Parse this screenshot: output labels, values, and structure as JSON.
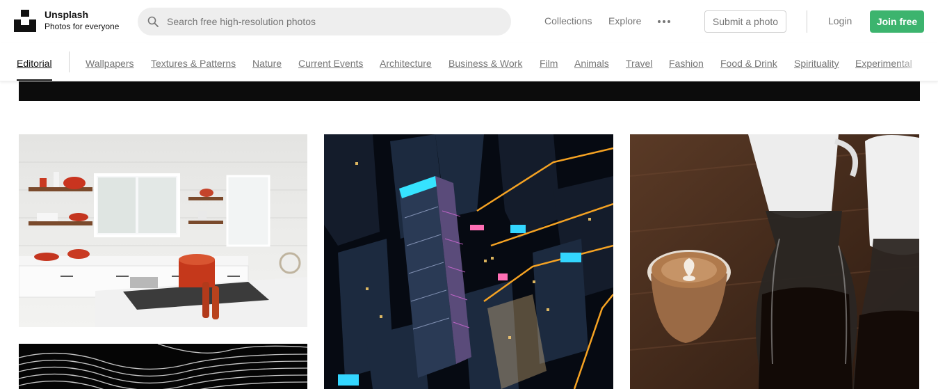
{
  "brand": {
    "name": "Unsplash",
    "tagline": "Photos for everyone",
    "logo_icon": "unsplash-logo-icon"
  },
  "search": {
    "placeholder": "Search free high-resolution photos",
    "value": "",
    "icon": "search-icon"
  },
  "nav": {
    "collections": "Collections",
    "explore": "Explore",
    "more_icon": "more-horizontal-icon",
    "submit": "Submit a photo",
    "login": "Login",
    "join": "Join free"
  },
  "topics": {
    "active": "Editorial",
    "items": [
      "Wallpapers",
      "Textures & Patterns",
      "Nature",
      "Current Events",
      "Architecture",
      "Business & Work",
      "Film",
      "Animals",
      "Travel",
      "Fashion",
      "Food & Drink",
      "Spirituality",
      "Experimental"
    ]
  },
  "colors": {
    "accent_green": "#3cb46e",
    "text_primary": "#111111",
    "text_secondary": "#767676",
    "search_bg": "#eeeeee"
  },
  "photos": [
    {
      "subject": "white kitchen with red cookware"
    },
    {
      "subject": "aerial city at night"
    },
    {
      "subject": "latte and coffee carafes"
    },
    {
      "subject": "black and white wavy lines"
    }
  ]
}
